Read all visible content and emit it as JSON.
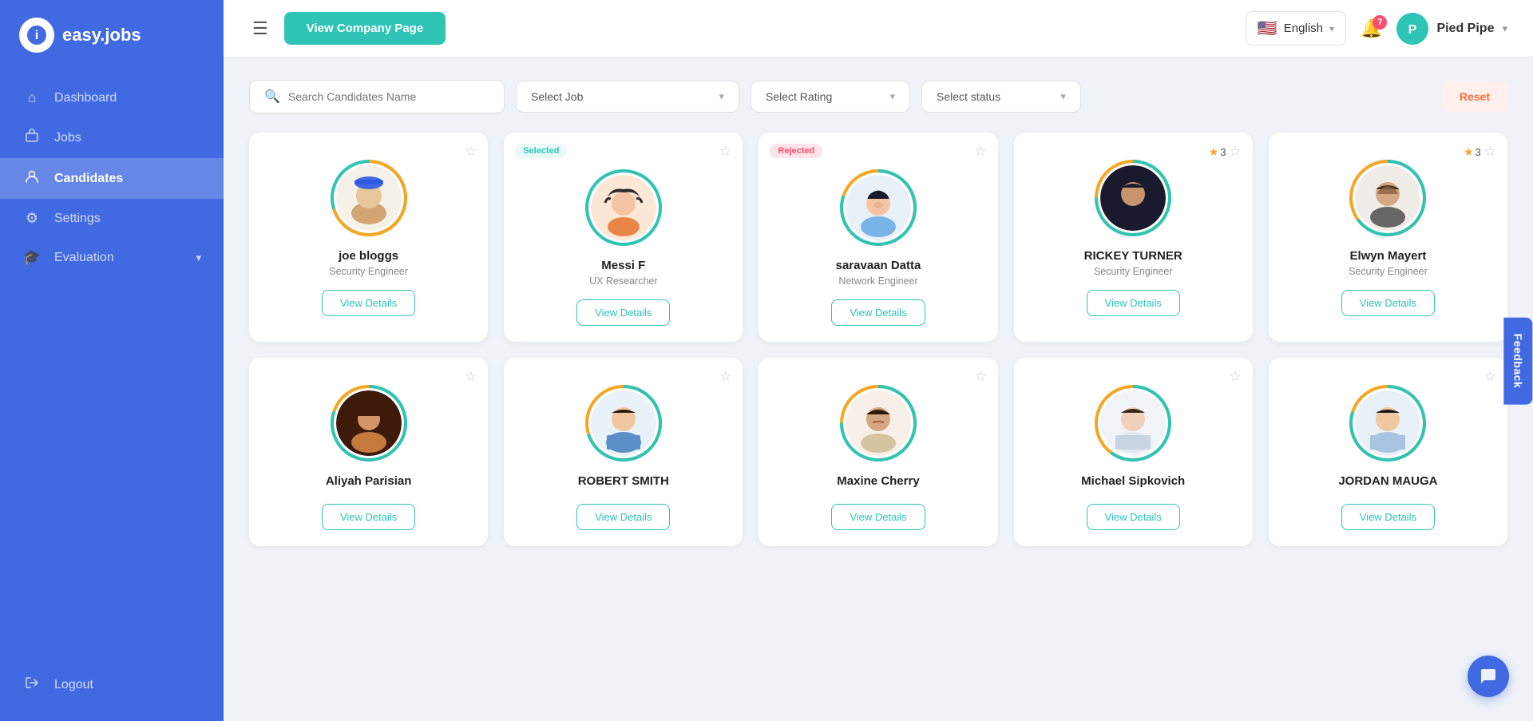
{
  "app": {
    "name": "easy.jobs",
    "logo_letter": "i"
  },
  "header": {
    "menu_icon": "☰",
    "view_company_btn": "View Company Page",
    "language": "English",
    "notification_count": "7",
    "user_name": "Pied Pipe",
    "user_initials": "P"
  },
  "sidebar": {
    "items": [
      {
        "id": "dashboard",
        "label": "Dashboard",
        "icon": "⌂"
      },
      {
        "id": "jobs",
        "label": "Jobs",
        "icon": "💼"
      },
      {
        "id": "candidates",
        "label": "Candidates",
        "icon": "👤",
        "active": true
      },
      {
        "id": "settings",
        "label": "Settings",
        "icon": "⚙"
      },
      {
        "id": "evaluation",
        "label": "Evaluation",
        "icon": "🎓",
        "has_chevron": true
      }
    ],
    "logout": {
      "label": "Logout",
      "icon": "➜"
    }
  },
  "filters": {
    "search_placeholder": "Search Candidates Name",
    "select_job_label": "Select Job",
    "select_rating_label": "Select Rating",
    "select_status_label": "Select status",
    "reset_label": "Reset"
  },
  "candidates": [
    {
      "id": 1,
      "name": "joe bloggs",
      "role": "Security Engineer",
      "badge": null,
      "star_rating": null,
      "ring_color1": "#f5a623",
      "ring_color2": "#2ec4b6",
      "ring_pct": 70,
      "avatar_type": "hat"
    },
    {
      "id": 2,
      "name": "Messi F",
      "role": "UX Researcher",
      "badge": "Selected",
      "badge_type": "selected",
      "star_rating": null,
      "ring_color1": "#2ec4b6",
      "ring_color2": "#f0f0f0",
      "ring_pct": 100,
      "avatar_type": "female"
    },
    {
      "id": 3,
      "name": "saravaan Datta",
      "role": "Network Engineer",
      "badge": "Rejected",
      "badge_type": "rejected",
      "star_rating": null,
      "ring_color1": "#2ec4b6",
      "ring_color2": "#f5a623",
      "ring_pct": 80,
      "avatar_type": "man1"
    },
    {
      "id": 4,
      "name": "RICKEY TURNER",
      "role": "Security Engineer",
      "badge": null,
      "star_rating": 3,
      "ring_color1": "#2ec4b6",
      "ring_color2": "#f5a623",
      "ring_pct": 75,
      "avatar_type": "man2"
    },
    {
      "id": 5,
      "name": "Elwyn Mayert",
      "role": "Security Engineer",
      "badge": null,
      "star_rating": 3,
      "ring_color1": "#2ec4b6",
      "ring_color2": "#f5a623",
      "ring_pct": 65,
      "avatar_type": "man3"
    },
    {
      "id": 6,
      "name": "Aliyah Parisian",
      "role": "",
      "badge": null,
      "star_rating": null,
      "ring_color1": "#2ec4b6",
      "ring_color2": "#f5a623",
      "ring_pct": 80,
      "avatar_type": "woman1"
    },
    {
      "id": 7,
      "name": "ROBERT SMITH",
      "role": "",
      "badge": null,
      "star_rating": null,
      "ring_color1": "#2ec4b6",
      "ring_color2": "#f5a623",
      "ring_pct": 70,
      "avatar_type": "man4"
    },
    {
      "id": 8,
      "name": "Maxine Cherry",
      "role": "",
      "badge": null,
      "star_rating": null,
      "ring_color1": "#2ec4b6",
      "ring_color2": "#f5a623",
      "ring_pct": 75,
      "avatar_type": "man5"
    },
    {
      "id": 9,
      "name": "Michael Sipkovich",
      "role": "",
      "badge": null,
      "star_rating": null,
      "ring_color1": "#2ec4b6",
      "ring_color2": "#f5a623",
      "ring_pct": 60,
      "avatar_type": "man6"
    },
    {
      "id": 10,
      "name": "JORDAN MAUGA",
      "role": "",
      "badge": null,
      "star_rating": null,
      "ring_color1": "#2ec4b6",
      "ring_color2": "#f5a623",
      "ring_pct": 80,
      "avatar_type": "man7"
    }
  ],
  "buttons": {
    "view_details": "View Details",
    "feedback": "Feedback"
  },
  "colors": {
    "sidebar_bg": "#4169e1",
    "accent": "#2ec4b6",
    "reset_btn_bg": "#fff0ec",
    "reset_btn_color": "#ff6b3d",
    "selected_badge_bg": "#e8f9f7",
    "selected_badge_color": "#2ec4b6",
    "rejected_badge_bg": "#ffe4ea",
    "rejected_badge_color": "#ff4d6d"
  }
}
